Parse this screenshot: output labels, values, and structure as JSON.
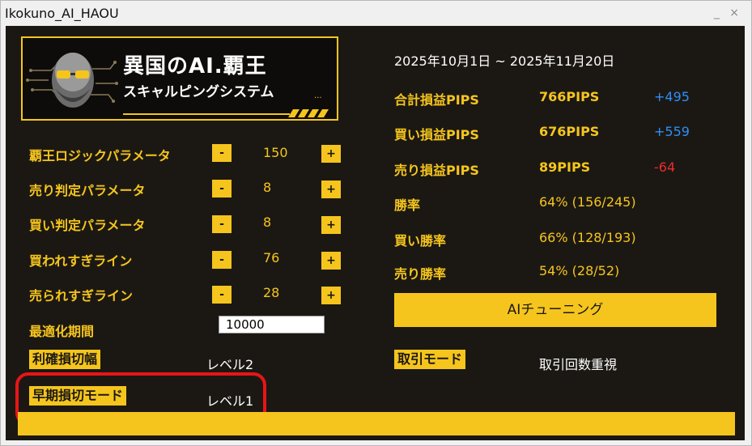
{
  "window": {
    "title": "Ikokuno_AI_HAOU",
    "controls": "_ ×"
  },
  "logo": {
    "line1": "異国のAI.覇王",
    "line2": "スキャルピングシステム",
    "mark": "..."
  },
  "params": [
    {
      "label": "覇王ロジックパラメータ",
      "minus": "-",
      "value": "150",
      "plus": "+"
    },
    {
      "label": "売り判定パラメータ",
      "minus": "-",
      "value": "8",
      "plus": "+"
    },
    {
      "label": "買い判定パラメータ",
      "minus": "-",
      "value": "8",
      "plus": "+"
    },
    {
      "label": "買われすぎライン",
      "minus": "-",
      "value": "76",
      "plus": "+"
    },
    {
      "label": "売られすぎライン",
      "minus": "-",
      "value": "28",
      "plus": "+"
    }
  ],
  "optimization": {
    "label": "最適化期間",
    "value": "10000"
  },
  "tp_sl": {
    "button": "利確損切幅",
    "value": "レベル2"
  },
  "early_sl": {
    "button": "早期損切モード",
    "value": "レベル1"
  },
  "stats": {
    "period": "2025年10月1日 ~ 2025年11月20日",
    "rows": [
      {
        "label": "合計損益PIPS",
        "value": "766PIPS",
        "delta": "+495",
        "delta_color": "blue"
      },
      {
        "label": "買い損益PIPS",
        "value": "676PIPS",
        "delta": "+559",
        "delta_color": "blue"
      },
      {
        "label": "売り損益PIPS",
        "value": "89PIPS",
        "delta": "-64",
        "delta_color": "red"
      },
      {
        "label": "勝率",
        "value": "64% (156/245)"
      },
      {
        "label": "買い勝率",
        "value": "66% (128/193)"
      },
      {
        "label": "売り勝率",
        "value": "54% (28/52)"
      }
    ]
  },
  "ai_tuning": {
    "label": "AIチューニング"
  },
  "trade_mode": {
    "button": "取引モード",
    "value": "取引回数重視"
  },
  "colors": {
    "accent": "#f5c51d",
    "panel": "#1b1814",
    "blue": "#2f8ff5",
    "red": "#ef2a2a",
    "highlight": "#e81515"
  }
}
